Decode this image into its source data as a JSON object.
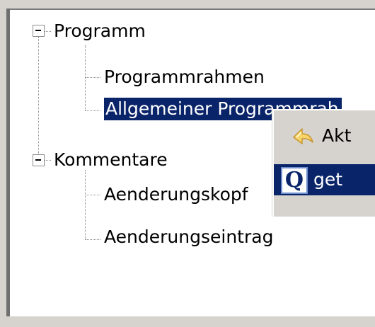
{
  "tree": {
    "nodes": [
      {
        "label": "Programm",
        "expander": "−"
      },
      {
        "label": "Programmrahmen"
      },
      {
        "label": "Allgemeiner Programmrah",
        "selected": true
      },
      {
        "label": "Kommentare",
        "expander": "−"
      },
      {
        "label": "Aenderungskopf"
      },
      {
        "label": "Aenderungseintrag"
      }
    ]
  },
  "context_menu": {
    "items": [
      {
        "label": "Akt",
        "icon": "yellow-arrow-icon"
      },
      {
        "label": "get",
        "icon": "q-app-icon",
        "highlighted": true
      }
    ]
  },
  "colors": {
    "selection": "#0a246a",
    "menu_background": "#d6d3ce",
    "tree_lines": "#8c8c8c"
  }
}
